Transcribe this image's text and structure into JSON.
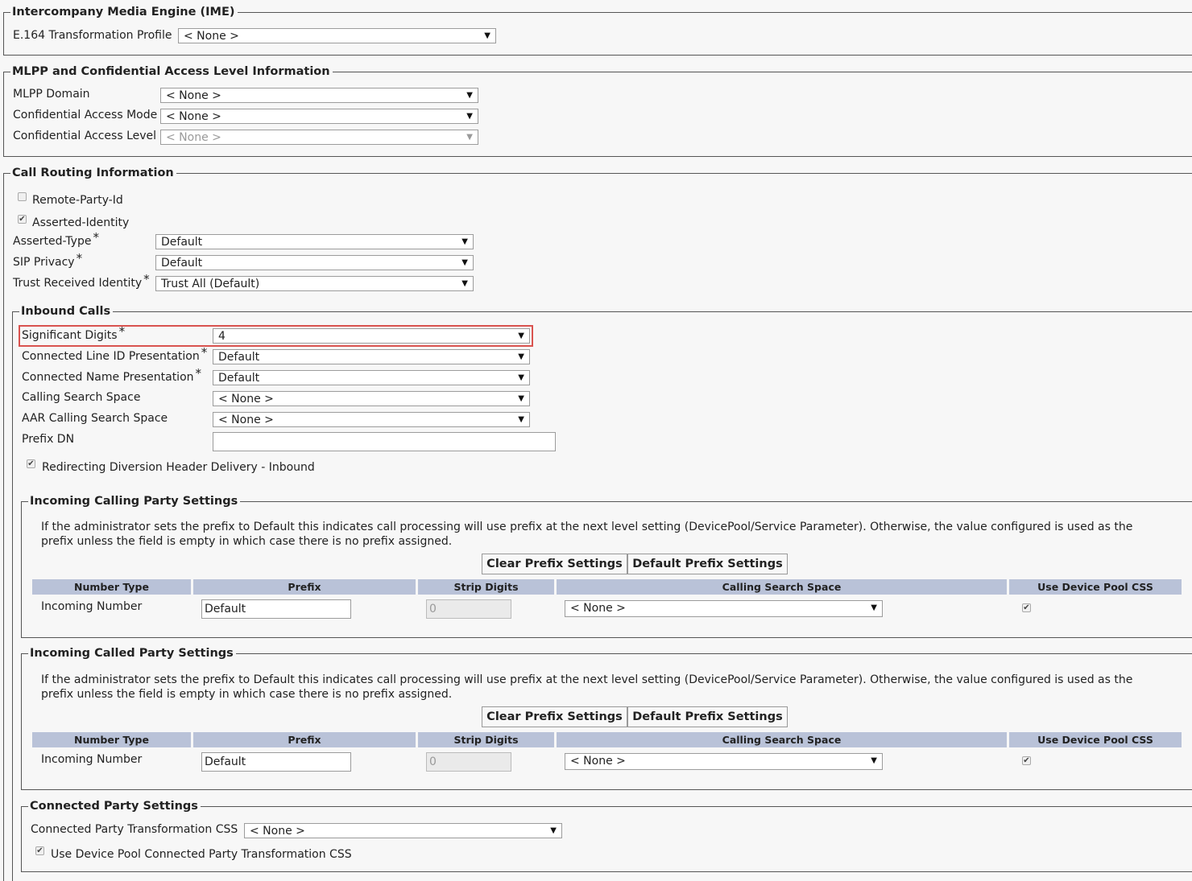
{
  "ime": {
    "title": "Intercompany Media Engine (IME)",
    "e164_label": "E.164 Transformation Profile",
    "e164_value": "< None >"
  },
  "mlpp": {
    "title": "MLPP and Confidential Access Level Information",
    "domain_label": "MLPP Domain",
    "domain_value": "< None >",
    "cam_label": "Confidential Access Mode",
    "cam_value": "< None >",
    "cal_label": "Confidential Access Level",
    "cal_value": "< None >"
  },
  "routing": {
    "title": "Call Routing Information",
    "remote_party_label": "Remote-Party-Id",
    "remote_party_checked": false,
    "asserted_identity_label": "Asserted-Identity",
    "asserted_identity_checked": true,
    "asserted_type_label": "Asserted-Type",
    "asserted_type_value": "Default",
    "sip_privacy_label": "SIP Privacy",
    "sip_privacy_value": "Default",
    "trust_label": "Trust Received Identity",
    "trust_value": "Trust All (Default)",
    "required_mark": "*"
  },
  "inbound": {
    "title": "Inbound Calls",
    "sig_digits_label": "Significant Digits",
    "sig_digits_value": "4",
    "clid_label": "Connected Line ID Presentation",
    "clid_value": "Default",
    "cname_label": "Connected Name Presentation",
    "cname_value": "Default",
    "css_label": "Calling Search Space",
    "css_value": "< None >",
    "aar_label": "AAR Calling Search Space",
    "aar_value": "< None >",
    "prefix_dn_label": "Prefix DN",
    "prefix_dn_value": "",
    "redirect_label": "Redirecting Diversion Header Delivery - Inbound",
    "redirect_checked": true
  },
  "calling_party": {
    "title": "Incoming Calling Party Settings",
    "description": "If the administrator sets the prefix to Default this indicates call processing will use prefix at the next level setting (DevicePool/Service Parameter). Otherwise, the value configured is used as the prefix unless the field is empty in which case there is no prefix assigned.",
    "clear_button": "Clear Prefix Settings",
    "default_button": "Default Prefix Settings",
    "headers": [
      "Number Type",
      "Prefix",
      "Strip Digits",
      "Calling Search Space",
      "Use Device Pool CSS"
    ],
    "row": {
      "type": "Incoming Number",
      "prefix": "Default",
      "strip": "0",
      "css": "< None >",
      "use_pool": true
    }
  },
  "called_party": {
    "title": "Incoming Called Party Settings",
    "description": "If the administrator sets the prefix to Default this indicates call processing will use prefix at the next level setting (DevicePool/Service Parameter). Otherwise, the value configured is used as the prefix unless the field is empty in which case there is no prefix assigned.",
    "clear_button": "Clear Prefix Settings",
    "default_button": "Default Prefix Settings",
    "headers": [
      "Number Type",
      "Prefix",
      "Strip Digits",
      "Calling Search Space",
      "Use Device Pool CSS"
    ],
    "row": {
      "type": "Incoming Number",
      "prefix": "Default",
      "strip": "0",
      "css": "< None >",
      "use_pool": true
    }
  },
  "connected_party": {
    "title": "Connected Party Settings",
    "css_label": "Connected Party Transformation CSS",
    "css_value": "< None >",
    "use_pool_label": "Use Device Pool Connected Party Transformation CSS",
    "use_pool_checked": true
  },
  "icons": {
    "dropdown": "triangle-down-icon",
    "check": "checkmark-icon"
  },
  "colors": {
    "highlight": "#d9534f",
    "table_header": "#b9c2d8"
  }
}
